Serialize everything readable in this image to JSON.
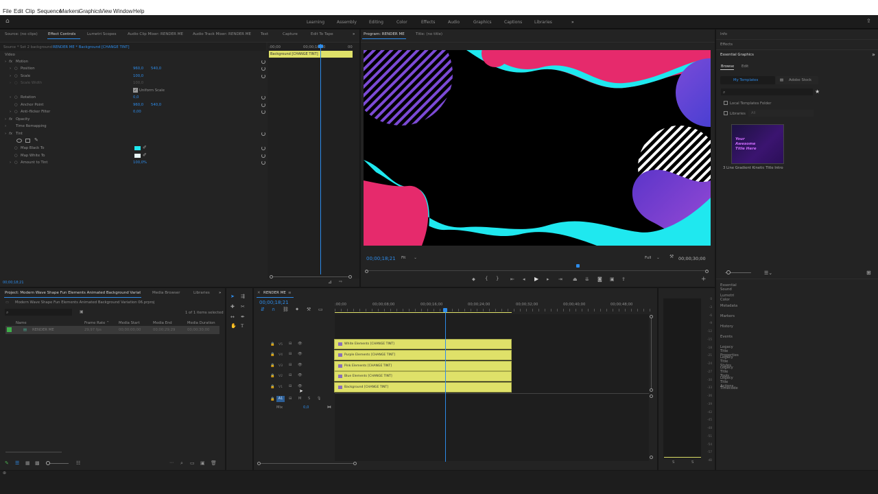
{
  "menu": [
    "File",
    "Edit",
    "Clip",
    "Sequence",
    "Markers",
    "Graphics",
    "View",
    "Window",
    "Help"
  ],
  "workspaces": [
    "Learning",
    "Assembly",
    "Editing",
    "Color",
    "Effects",
    "Audio",
    "Graphics",
    "Captions",
    "Libraries"
  ],
  "source_panel": {
    "tabs": [
      "Source: (no clips)",
      "Effect Controls",
      "Lumetri Scopes",
      "Audio Clip Mixer: RENDER ME",
      "Audio Track Mixer: RENDER ME",
      "Text",
      "Capture",
      "Edit To Tape"
    ],
    "breadcrumb_source": "Source * Set 2 background",
    "breadcrumb_clip": "RENDER ME * Background [CHANGE TINT]",
    "ruler_start": ":00;00",
    "ruler_mid": "00;00;16;00",
    "ruler_end": "00",
    "clip_bar": "Background [CHANGE TINT]",
    "section_video": "Video",
    "rows": [
      {
        "label": "Motion",
        "fx": true
      },
      {
        "label": "Position",
        "v1": "960,0",
        "v2": "540,0"
      },
      {
        "label": "Scale",
        "v1": "100,0"
      },
      {
        "label": "Scale Width",
        "v1": "100,0"
      },
      {
        "label": "Uniform Scale"
      },
      {
        "label": "Rotation",
        "v1": "0,0"
      },
      {
        "label": "Anchor Point",
        "v1": "960,0",
        "v2": "540,0"
      },
      {
        "label": "Anti-flicker Filter",
        "v1": "0,00"
      },
      {
        "label": "Opacity",
        "fx": true
      },
      {
        "label": "Time Remapping"
      },
      {
        "label": "Tint",
        "fx": true
      },
      {
        "label": "Map Black To"
      },
      {
        "label": "Map White To"
      },
      {
        "label": "Amount to Tint",
        "v1": "100,0",
        "v2": "%"
      }
    ],
    "timecode": "00;00;18;21"
  },
  "program_panel": {
    "tab1": "Program: RENDER ME",
    "tab2": "Title: (no title)",
    "timecode": "00;00;18;21",
    "fit": "Fit",
    "quality": "Full",
    "duration": "00;00;30;00"
  },
  "essential_graphics": {
    "tabs_top": [
      "Info",
      "Effects",
      "Essential Graphics"
    ],
    "browse": "Browse",
    "edit": "Edit",
    "my_templates": "My Templates",
    "adobe_stock": "Adobe Stock",
    "local_templates": "Local Templates Folder",
    "libraries": "Libraries",
    "libraries_value": "All",
    "template_thumb_text": [
      "Your",
      "Awesome",
      "Title Here"
    ],
    "template_name": "3 Line Gradient Kinetic Title Intro",
    "panel_list": [
      "Essential Sound",
      "Lumetri Color",
      "Metadata",
      "Markers",
      "History",
      "Events",
      "Legacy Title Properties",
      "Legacy Title Styles",
      "Legacy Title Tools",
      "Legacy Title Actions",
      "Timecode"
    ]
  },
  "project_panel": {
    "tabs": [
      "Project: Modern Wave Shape Fun Elements Animated Background Variation 06",
      "Media Browser",
      "Libraries"
    ],
    "path": "Modern Wave Shape Fun Elements Animated Background Variation 06.prproj",
    "count": "1 of 1 items selected",
    "columns": [
      "Name",
      "Frame Rate",
      "Media Start",
      "Media End",
      "Media Duration"
    ],
    "items": [
      {
        "name": "RENDER ME",
        "rate": "29,97 fps",
        "start": "00;00;00;00",
        "end": "00;00;29;29",
        "dur": "00;00;30;00"
      }
    ]
  },
  "timeline": {
    "tab": "RENDER ME",
    "timecode": "00;00;18;21",
    "ruler": [
      ":00;00",
      "00;00;08;00",
      "00;00;16;00",
      "00;00;24;00",
      "00;00;32;00",
      "00;00;40;00",
      "00;00;48;00"
    ],
    "tracks": [
      {
        "name": "V5",
        "clip": "White Elements [CHANGE TINT]"
      },
      {
        "name": "V4",
        "clip": "Purple Elements [CHANGE TINT]"
      },
      {
        "name": "V3",
        "clip": "Pink Elements [CHANGE TINT]"
      },
      {
        "name": "V2",
        "clip": "Blue Elements [CHANGE TINT]"
      },
      {
        "name": "V1",
        "clip": "Background [CHANGE TINT]"
      }
    ],
    "audio_track": "A1",
    "mix_label": "Mix",
    "mix_value": "0,0"
  },
  "audio_meter": {
    "ticks": [
      "0",
      "-3",
      "-6",
      "-9",
      "-12",
      "-15",
      "-18",
      "-21",
      "-24",
      "-27",
      "-30",
      "-33",
      "-36",
      "-39",
      "-42",
      "-45",
      "-48",
      "-51",
      "-54",
      "-57",
      "dB"
    ],
    "footer": [
      "S",
      "S"
    ]
  },
  "colors": {
    "accent": "#2d8ceb",
    "clip": "#dfe169",
    "cyan": "#1fe8ef",
    "pink": "#e62a6c",
    "purple": "#6b3fd0"
  }
}
